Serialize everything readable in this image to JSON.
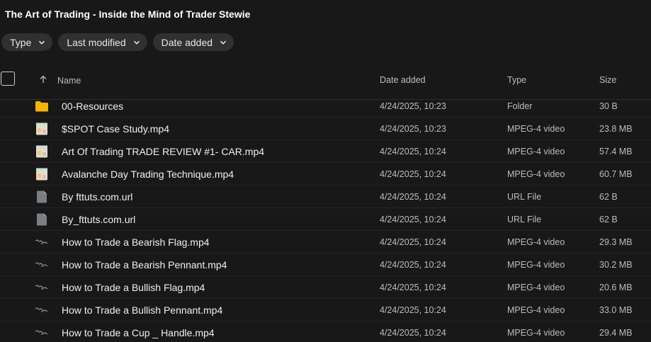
{
  "title": "The Art of Trading - Inside the Mind of Trader Stewie",
  "filters": [
    {
      "label": "Type",
      "icon": "chevron-down-icon"
    },
    {
      "label": "Last modified",
      "icon": "chevron-down-icon"
    },
    {
      "label": "Date added",
      "icon": "chevron-down-icon"
    }
  ],
  "columns": {
    "name": "Name",
    "date_added": "Date added",
    "type": "Type",
    "size": "Size"
  },
  "rows": [
    {
      "name": "00-Resources",
      "date": "4/24/2025, 10:23",
      "type": "Folder",
      "size": "30 B",
      "icon": "folder-icon"
    },
    {
      "name": "$SPOT Case Study.mp4",
      "date": "4/24/2025, 10:23",
      "type": "MPEG-4 video",
      "size": "23.8 MB",
      "icon": "video-thumbnail-icon"
    },
    {
      "name": "Art Of Trading TRADE REVIEW #1- CAR.mp4",
      "date": "4/24/2025, 10:24",
      "type": "MPEG-4 video",
      "size": "57.4 MB",
      "icon": "video-thumbnail-icon"
    },
    {
      "name": "Avalanche Day Trading Technique.mp4",
      "date": "4/24/2025, 10:24",
      "type": "MPEG-4 video",
      "size": "60.7 MB",
      "icon": "video-thumbnail-icon"
    },
    {
      "name": "By fttuts.com.url",
      "date": "4/24/2025, 10:24",
      "type": "URL File",
      "size": "62 B",
      "icon": "file-icon"
    },
    {
      "name": "By_fttuts.com.url",
      "date": "4/24/2025, 10:24",
      "type": "URL File",
      "size": "62 B",
      "icon": "file-icon"
    },
    {
      "name": "How to Trade a Bearish Flag.mp4",
      "date": "4/24/2025, 10:24",
      "type": "MPEG-4 video",
      "size": "29.3 MB",
      "icon": "chart-thumbnail-icon"
    },
    {
      "name": "How to Trade a Bearish Pennant.mp4",
      "date": "4/24/2025, 10:24",
      "type": "MPEG-4 video",
      "size": "30.2 MB",
      "icon": "chart-thumbnail-icon"
    },
    {
      "name": "How to Trade a Bullish Flag.mp4",
      "date": "4/24/2025, 10:24",
      "type": "MPEG-4 video",
      "size": "20.6 MB",
      "icon": "chart-thumbnail-icon"
    },
    {
      "name": "How to Trade a Bullish Pennant.mp4",
      "date": "4/24/2025, 10:24",
      "type": "MPEG-4 video",
      "size": "33.0 MB",
      "icon": "chart-thumbnail-icon"
    },
    {
      "name": "How to Trade a Cup _ Handle.mp4",
      "date": "4/24/2025, 10:24",
      "type": "MPEG-4 video",
      "size": "29.4 MB",
      "icon": "chart-thumbnail-icon"
    }
  ],
  "colors": {
    "background": "#181818",
    "chip": "#303030",
    "folder": "#f5b400"
  }
}
